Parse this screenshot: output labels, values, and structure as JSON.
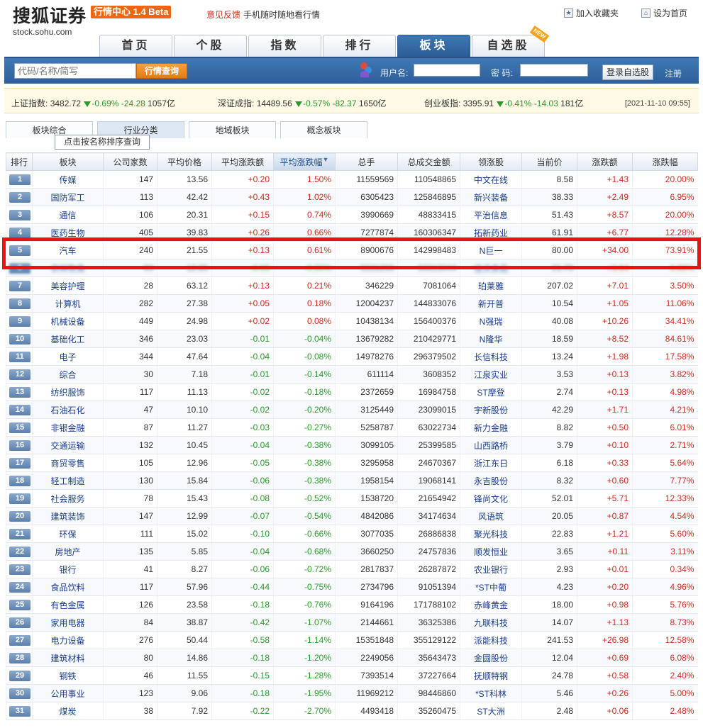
{
  "header": {
    "logo_text": "搜狐证券",
    "logo_url": "stock.sohu.com",
    "product_badge": "行情中心 1.4 Beta",
    "feedback": "意见反馈",
    "mobile": "手机随时随地看行情",
    "favorite": "加入收藏夹",
    "homepage": "设为首页"
  },
  "nav": {
    "tabs": [
      {
        "label": "首页",
        "active": false
      },
      {
        "label": "个股",
        "active": false
      },
      {
        "label": "指数",
        "active": false
      },
      {
        "label": "排行",
        "active": false
      },
      {
        "label": "板块",
        "active": true
      },
      {
        "label": "自选股",
        "active": false
      }
    ],
    "new_flag": "NEW"
  },
  "search": {
    "placeholder": "代码/名称/简写",
    "button": "行情查询"
  },
  "login": {
    "username_label": "用户名:",
    "password_label": "密 码:",
    "login_button": "登录自选股",
    "register": "注册"
  },
  "indices": [
    {
      "name": "上证指数:",
      "value": "3482.72",
      "pct": "-0.69%",
      "chg": "-24.28",
      "vol": "1057亿"
    },
    {
      "name": "深证成指:",
      "value": "14489.56",
      "pct": "-0.57%",
      "chg": "-82.37",
      "vol": "1650亿"
    },
    {
      "name": "创业板指:",
      "value": "3395.91",
      "pct": "-0.41%",
      "chg": "-14.03",
      "vol": "181亿"
    }
  ],
  "timestamp": "[2021-11-10 09:55]",
  "subtabs": [
    "板块综合",
    "行业分类",
    "地域板块",
    "概念板块"
  ],
  "tooltip": "点击按名称排序查询",
  "table": {
    "headers": [
      "排行",
      "板块",
      "公司家数",
      "平均价格",
      "平均涨跌额",
      "平均涨跌幅",
      "总手",
      "总成交金额",
      "领涨股",
      "当前价",
      "涨跌额",
      "涨跌幅"
    ],
    "sorted_col": 5,
    "rows": [
      [
        "1",
        "传媒",
        "147",
        "13.56",
        "+0.20",
        "1.50%",
        "11559569",
        "110548865",
        "中文在线",
        "8.58",
        "+1.43",
        "20.00%"
      ],
      [
        "2",
        "国防军工",
        "113",
        "42.42",
        "+0.43",
        "1.02%",
        "6305423",
        "125846895",
        "新兴装备",
        "38.33",
        "+2.49",
        "6.95%"
      ],
      [
        "3",
        "通信",
        "106",
        "20.31",
        "+0.15",
        "0.74%",
        "3990669",
        "48833415",
        "平治信息",
        "51.43",
        "+8.57",
        "20.00%"
      ],
      [
        "4",
        "医药生物",
        "405",
        "39.83",
        "+0.26",
        "0.66%",
        "7277874",
        "160306347",
        "拓新药业",
        "61.91",
        "+6.77",
        "12.28%"
      ],
      [
        "5",
        "汽车",
        "240",
        "21.55",
        "+0.13",
        "0.61%",
        "8900676",
        "142998483",
        "N巨一",
        "80.00",
        "+34.00",
        "73.91%"
      ],
      [
        "6",
        "农林牧渔",
        "99",
        "12.85",
        "-0.05",
        "-0.36%",
        "5531266",
        "50813044",
        "佳沃食品",
        "21.78",
        "+3.64",
        "0.99%"
      ],
      [
        "7",
        "美容护理",
        "28",
        "63.12",
        "+0.13",
        "0.21%",
        "346229",
        "7081064",
        "珀莱雅",
        "207.02",
        "+7.01",
        "3.50%"
      ],
      [
        "8",
        "计算机",
        "282",
        "27.38",
        "+0.05",
        "0.18%",
        "12004237",
        "144833076",
        "新开普",
        "10.54",
        "+1.05",
        "11.06%"
      ],
      [
        "9",
        "机械设备",
        "449",
        "24.98",
        "+0.02",
        "0.08%",
        "10438134",
        "156400376",
        "N强瑞",
        "40.08",
        "+10.26",
        "34.41%"
      ],
      [
        "10",
        "基础化工",
        "346",
        "23.03",
        "-0.01",
        "-0.04%",
        "13679282",
        "210429771",
        "N隆华",
        "18.59",
        "+8.52",
        "84.61%"
      ],
      [
        "11",
        "电子",
        "344",
        "47.64",
        "-0.04",
        "-0.08%",
        "14978276",
        "296379502",
        "长信科技",
        "13.24",
        "+1.98",
        "17.58%"
      ],
      [
        "12",
        "综合",
        "30",
        "7.18",
        "-0.01",
        "-0.14%",
        "611114",
        "3608352",
        "江泉实业",
        "3.53",
        "+0.13",
        "3.82%"
      ],
      [
        "13",
        "纺织服饰",
        "117",
        "11.13",
        "-0.02",
        "-0.18%",
        "2372659",
        "16984758",
        "ST摩登",
        "2.74",
        "+0.13",
        "4.98%"
      ],
      [
        "14",
        "石油石化",
        "47",
        "10.10",
        "-0.02",
        "-0.20%",
        "3125449",
        "23099015",
        "宇新股份",
        "42.29",
        "+1.71",
        "4.21%"
      ],
      [
        "15",
        "非银金融",
        "87",
        "11.27",
        "-0.03",
        "-0.27%",
        "5258787",
        "63022734",
        "新力金融",
        "8.82",
        "+0.50",
        "6.01%"
      ],
      [
        "16",
        "交通运输",
        "132",
        "10.45",
        "-0.04",
        "-0.38%",
        "3099105",
        "25399585",
        "山西路桥",
        "3.79",
        "+0.10",
        "2.71%"
      ],
      [
        "17",
        "商贸零售",
        "105",
        "12.96",
        "-0.05",
        "-0.38%",
        "3295958",
        "24670367",
        "浙江东日",
        "6.18",
        "+0.33",
        "5.64%"
      ],
      [
        "18",
        "轻工制造",
        "130",
        "15.84",
        "-0.06",
        "-0.38%",
        "1958154",
        "19068141",
        "永吉股份",
        "8.32",
        "+0.60",
        "7.77%"
      ],
      [
        "19",
        "社会服务",
        "78",
        "15.43",
        "-0.08",
        "-0.52%",
        "1538720",
        "21654942",
        "锋尚文化",
        "52.01",
        "+5.71",
        "12.33%"
      ],
      [
        "20",
        "建筑装饰",
        "147",
        "12.99",
        "-0.07",
        "-0.54%",
        "4842086",
        "34174634",
        "风语筑",
        "20.05",
        "+0.87",
        "4.54%"
      ],
      [
        "21",
        "环保",
        "111",
        "15.02",
        "-0.10",
        "-0.66%",
        "3077035",
        "26886838",
        "聚光科技",
        "22.83",
        "+1.21",
        "5.60%"
      ],
      [
        "22",
        "房地产",
        "135",
        "5.85",
        "-0.04",
        "-0.68%",
        "3660250",
        "24757836",
        "顺发恒业",
        "3.65",
        "+0.11",
        "3.11%"
      ],
      [
        "23",
        "银行",
        "41",
        "8.27",
        "-0.06",
        "-0.72%",
        "2817837",
        "26287872",
        "农业银行",
        "2.93",
        "+0.01",
        "0.34%"
      ],
      [
        "24",
        "食品饮料",
        "117",
        "57.96",
        "-0.44",
        "-0.75%",
        "2734796",
        "91051394",
        "*ST中葡",
        "4.23",
        "+0.20",
        "4.96%"
      ],
      [
        "25",
        "有色金属",
        "126",
        "23.58",
        "-0.18",
        "-0.76%",
        "9164196",
        "171788102",
        "赤峰黄金",
        "18.00",
        "+0.98",
        "5.76%"
      ],
      [
        "26",
        "家用电器",
        "84",
        "38.87",
        "-0.42",
        "-1.07%",
        "2144661",
        "36325386",
        "九联科技",
        "14.07",
        "+1.13",
        "8.73%"
      ],
      [
        "27",
        "电力设备",
        "276",
        "50.44",
        "-0.58",
        "-1.14%",
        "15351848",
        "355129122",
        "派能科技",
        "241.53",
        "+26.98",
        "12.58%"
      ],
      [
        "28",
        "建筑材料",
        "80",
        "14.86",
        "-0.18",
        "-1.20%",
        "2249056",
        "35643473",
        "金圆股份",
        "12.04",
        "+0.69",
        "6.08%"
      ],
      [
        "29",
        "钢铁",
        "46",
        "11.55",
        "-0.15",
        "-1.28%",
        "7393514",
        "37227664",
        "抚顺特钢",
        "24.78",
        "+0.58",
        "2.40%"
      ],
      [
        "30",
        "公用事业",
        "123",
        "9.06",
        "-0.18",
        "-1.95%",
        "11969212",
        "98446860",
        "*ST科林",
        "5.46",
        "+0.26",
        "5.00%"
      ],
      [
        "31",
        "煤炭",
        "38",
        "7.92",
        "-0.22",
        "-2.70%",
        "4493418",
        "35260475",
        "ST大洲",
        "2.48",
        "+0.06",
        "2.48%"
      ]
    ],
    "highlighted_row": 5,
    "blurred_row": 6
  },
  "colors": {
    "up": "#d02a1f",
    "down": "#2a9a2a",
    "link": "#1a3e8c",
    "nav_active": "#2a5c95",
    "highlight": "#ee1111"
  }
}
